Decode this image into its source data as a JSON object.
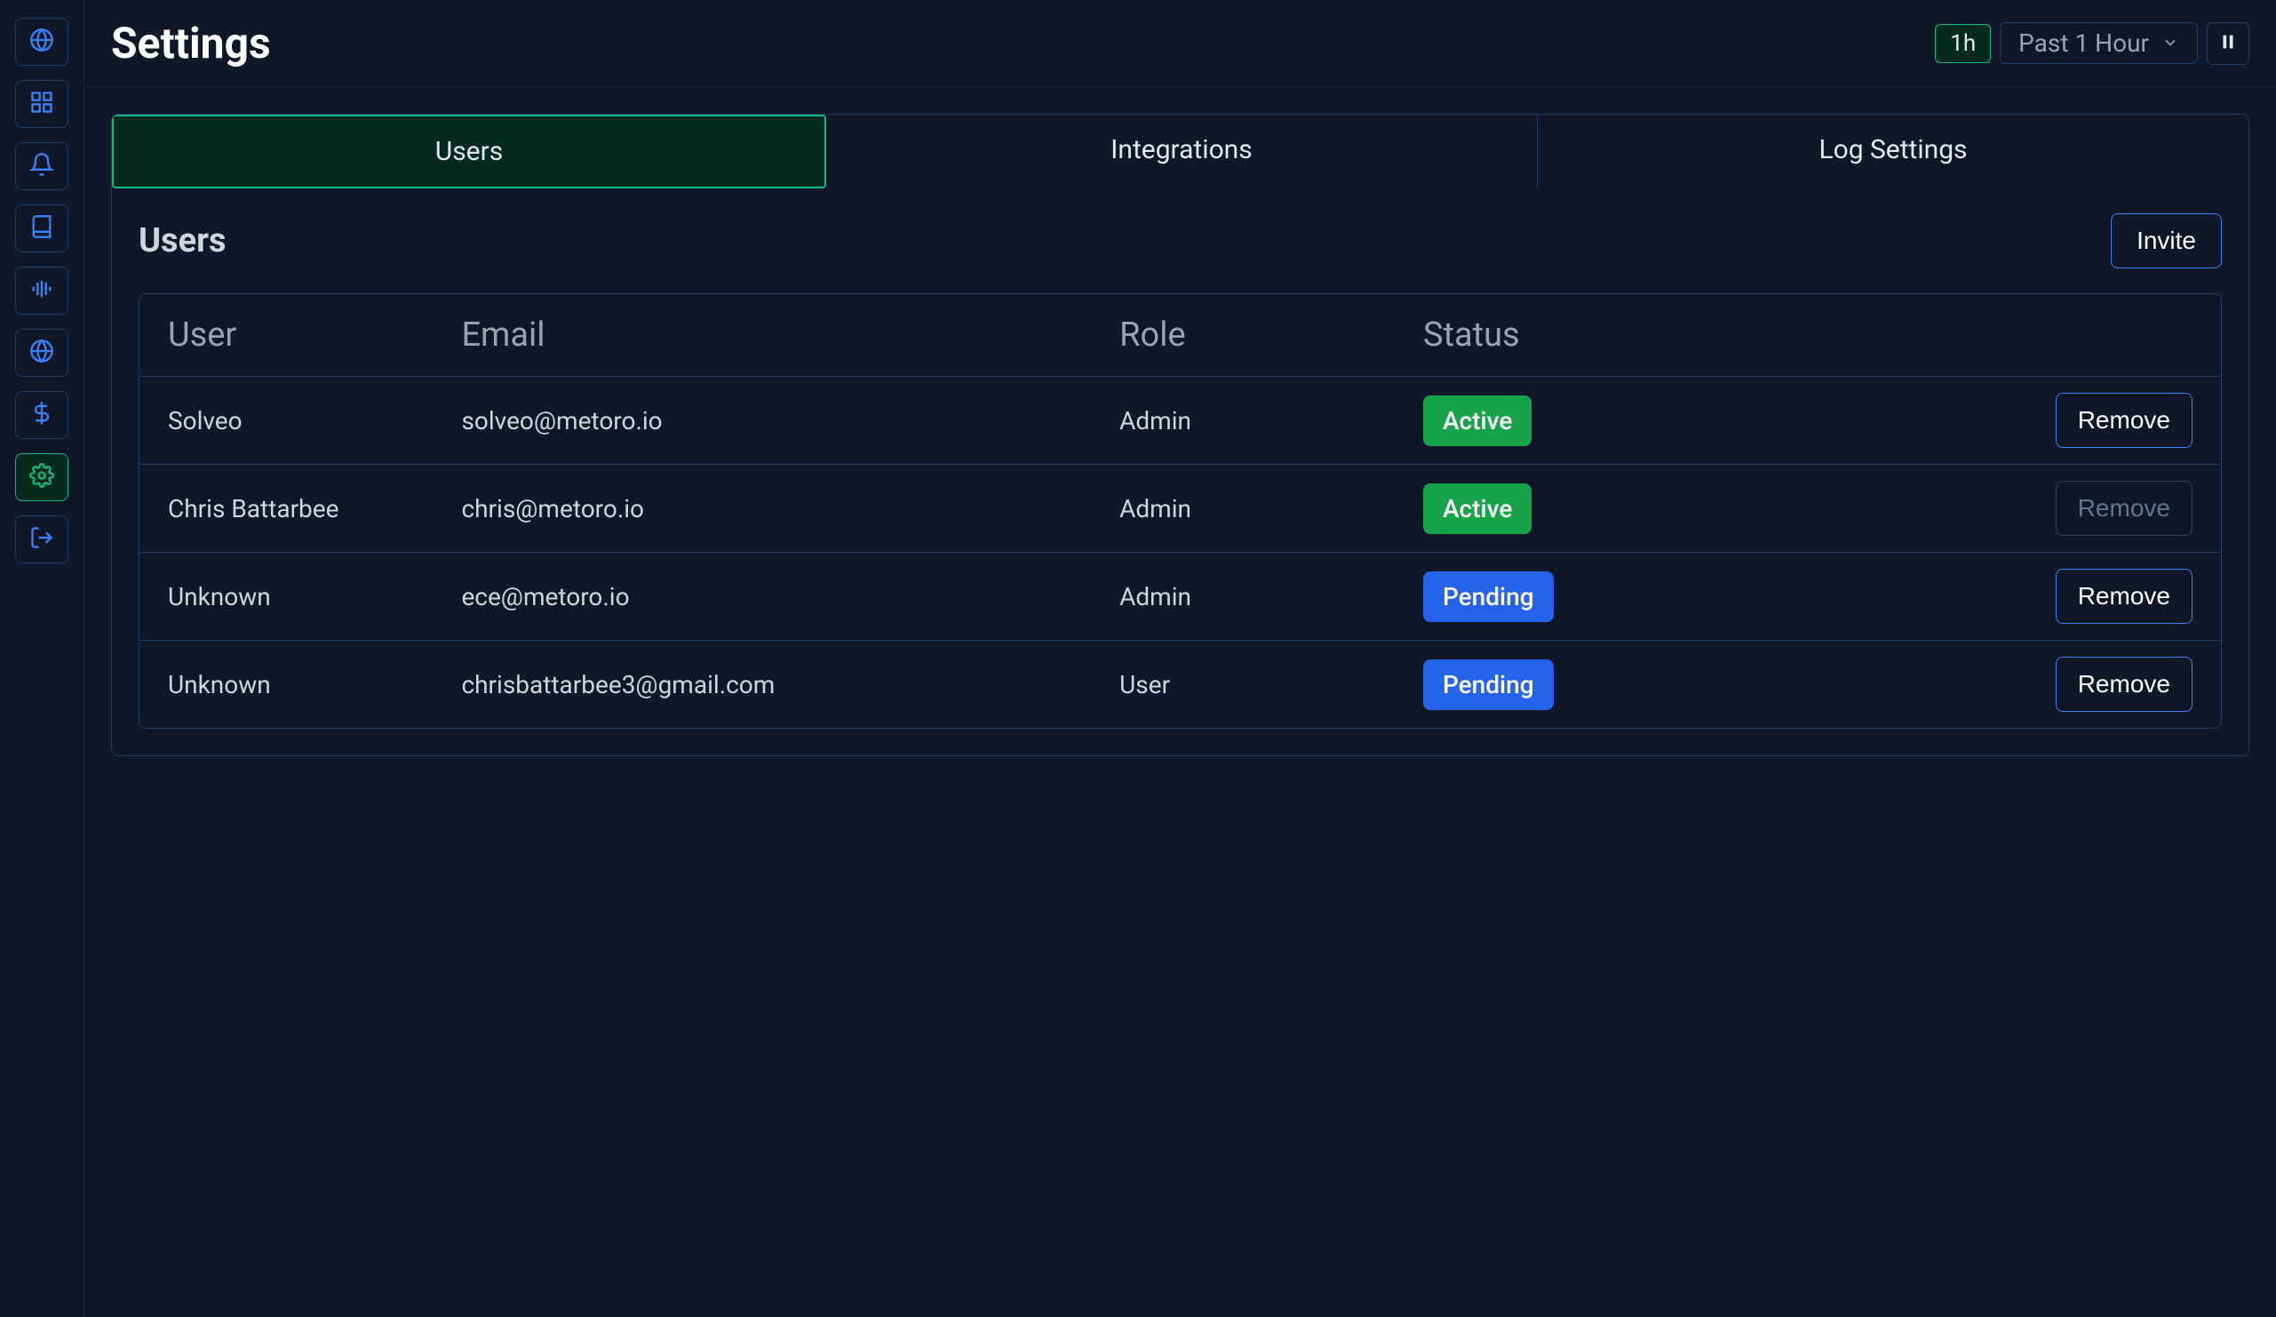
{
  "header": {
    "title": "Settings",
    "time_chip": "1h",
    "time_range_label": "Past 1 Hour"
  },
  "sidebar": {
    "items": [
      {
        "name": "globe"
      },
      {
        "name": "dashboard"
      },
      {
        "name": "bell"
      },
      {
        "name": "book"
      },
      {
        "name": "audio"
      },
      {
        "name": "globe2"
      },
      {
        "name": "dollar"
      },
      {
        "name": "gear",
        "active": true
      },
      {
        "name": "logout"
      }
    ]
  },
  "tabs": {
    "items": [
      {
        "label": "Users",
        "active": true
      },
      {
        "label": "Integrations"
      },
      {
        "label": "Log Settings"
      }
    ]
  },
  "panel": {
    "title": "Users",
    "invite_label": "Invite"
  },
  "table": {
    "headers": {
      "user": "User",
      "email": "Email",
      "role": "Role",
      "status": "Status"
    },
    "remove_label": "Remove",
    "rows": [
      {
        "user": "Solveo",
        "email": "solveo@metoro.io",
        "role": "Admin",
        "status": "Active",
        "status_class": "active",
        "remove_disabled": false
      },
      {
        "user": "Chris Battarbee",
        "email": "chris@metoro.io",
        "role": "Admin",
        "status": "Active",
        "status_class": "active",
        "remove_disabled": true
      },
      {
        "user": "Unknown",
        "email": "ece@metoro.io",
        "role": "Admin",
        "status": "Pending",
        "status_class": "pending",
        "remove_disabled": false
      },
      {
        "user": "Unknown",
        "email": "chrisbattarbee3@gmail.com",
        "role": "User",
        "status": "Pending",
        "status_class": "pending",
        "remove_disabled": false
      }
    ]
  },
  "colors": {
    "bg": "#0f1729",
    "border": "#1e3a5f",
    "accent_green": "#10b981",
    "accent_blue": "#3b82f6",
    "status_active": "#16a34a",
    "status_pending": "#2563eb"
  }
}
